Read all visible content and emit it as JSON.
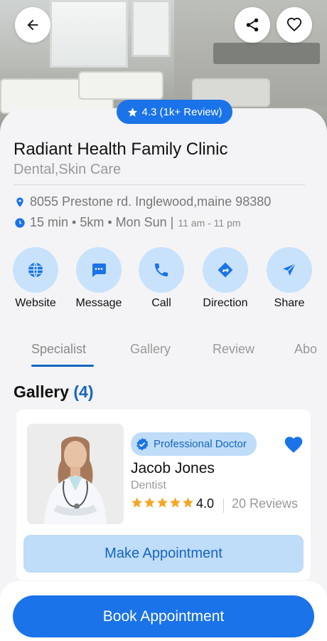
{
  "header": {
    "rating_text": "4.3 (1k+ Review)"
  },
  "clinic": {
    "name": "Radiant Health Family Clinic",
    "categories": "Dental,Skin Care",
    "address": "8055 Prestone rd. Inglewood,maine 98380",
    "travel_info": "15 min • 5km • Mon Sun |",
    "hours": "11 am - 11 pm"
  },
  "actions": [
    {
      "label": "Website",
      "icon": "globe-icon"
    },
    {
      "label": "Message",
      "icon": "message-icon"
    },
    {
      "label": "Call",
      "icon": "phone-icon"
    },
    {
      "label": "Direction",
      "icon": "direction-icon"
    },
    {
      "label": "Share",
      "icon": "send-icon"
    }
  ],
  "tabs": [
    {
      "label": "Specialist",
      "active": true
    },
    {
      "label": "Gallery",
      "active": false
    },
    {
      "label": "Review",
      "active": false
    },
    {
      "label": "Abo",
      "active": false
    }
  ],
  "gallery": {
    "title": "Gallery",
    "count": "(4)"
  },
  "doctor": {
    "badge": "Professional Doctor",
    "name": "Jacob Jones",
    "role": "Dentist",
    "rating": "4.0",
    "stars_filled": 5,
    "reviews": "20 Reviews",
    "favorite": true,
    "button": "Make Appointment"
  },
  "footer": {
    "button": "Book Appointment"
  },
  "colors": {
    "primary": "#1a73e8",
    "accent_light": "#c9e2fb",
    "star": "#f5a623"
  }
}
